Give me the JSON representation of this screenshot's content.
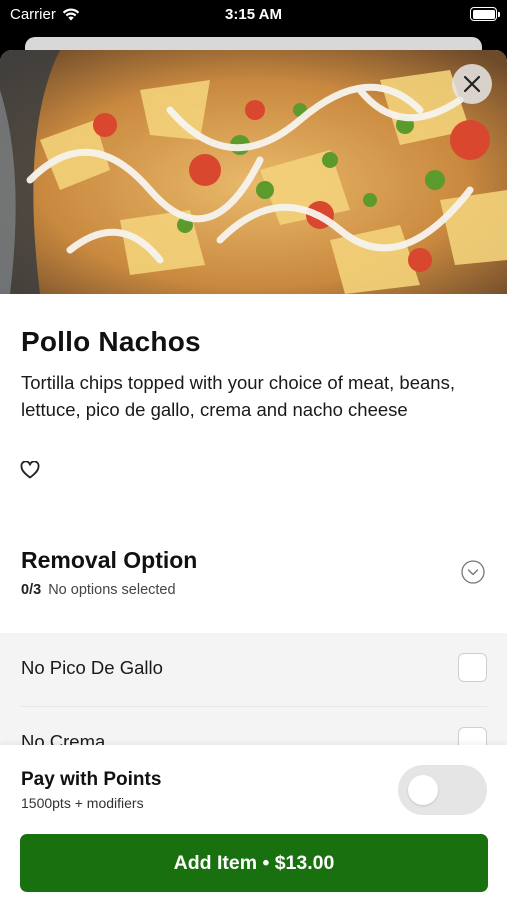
{
  "status_bar": {
    "carrier": "Carrier",
    "time": "3:15 AM"
  },
  "item": {
    "name": "Pollo Nachos",
    "description": "Tortilla chips topped with your choice of meat, beans, lettuce, pico de gallo, crema and nacho cheese",
    "favorited": false
  },
  "removal_section": {
    "title": "Removal Option",
    "count": "0/3",
    "status": "No options selected",
    "options": [
      {
        "label": "No Pico De Gallo",
        "checked": false
      },
      {
        "label": "No Crema",
        "checked": false
      }
    ]
  },
  "footer": {
    "pay_title": "Pay with Points",
    "pay_sub": "1500pts + modifiers",
    "points_toggle_on": false,
    "add_button_label": "Add Item • $13.00"
  },
  "colors": {
    "primary_button": "#19700f",
    "toggle_off": "#e5e5e5"
  },
  "icons": {
    "close": "close-icon",
    "favorite": "heart-outline-icon",
    "expand": "chevron-down-circle-icon"
  }
}
